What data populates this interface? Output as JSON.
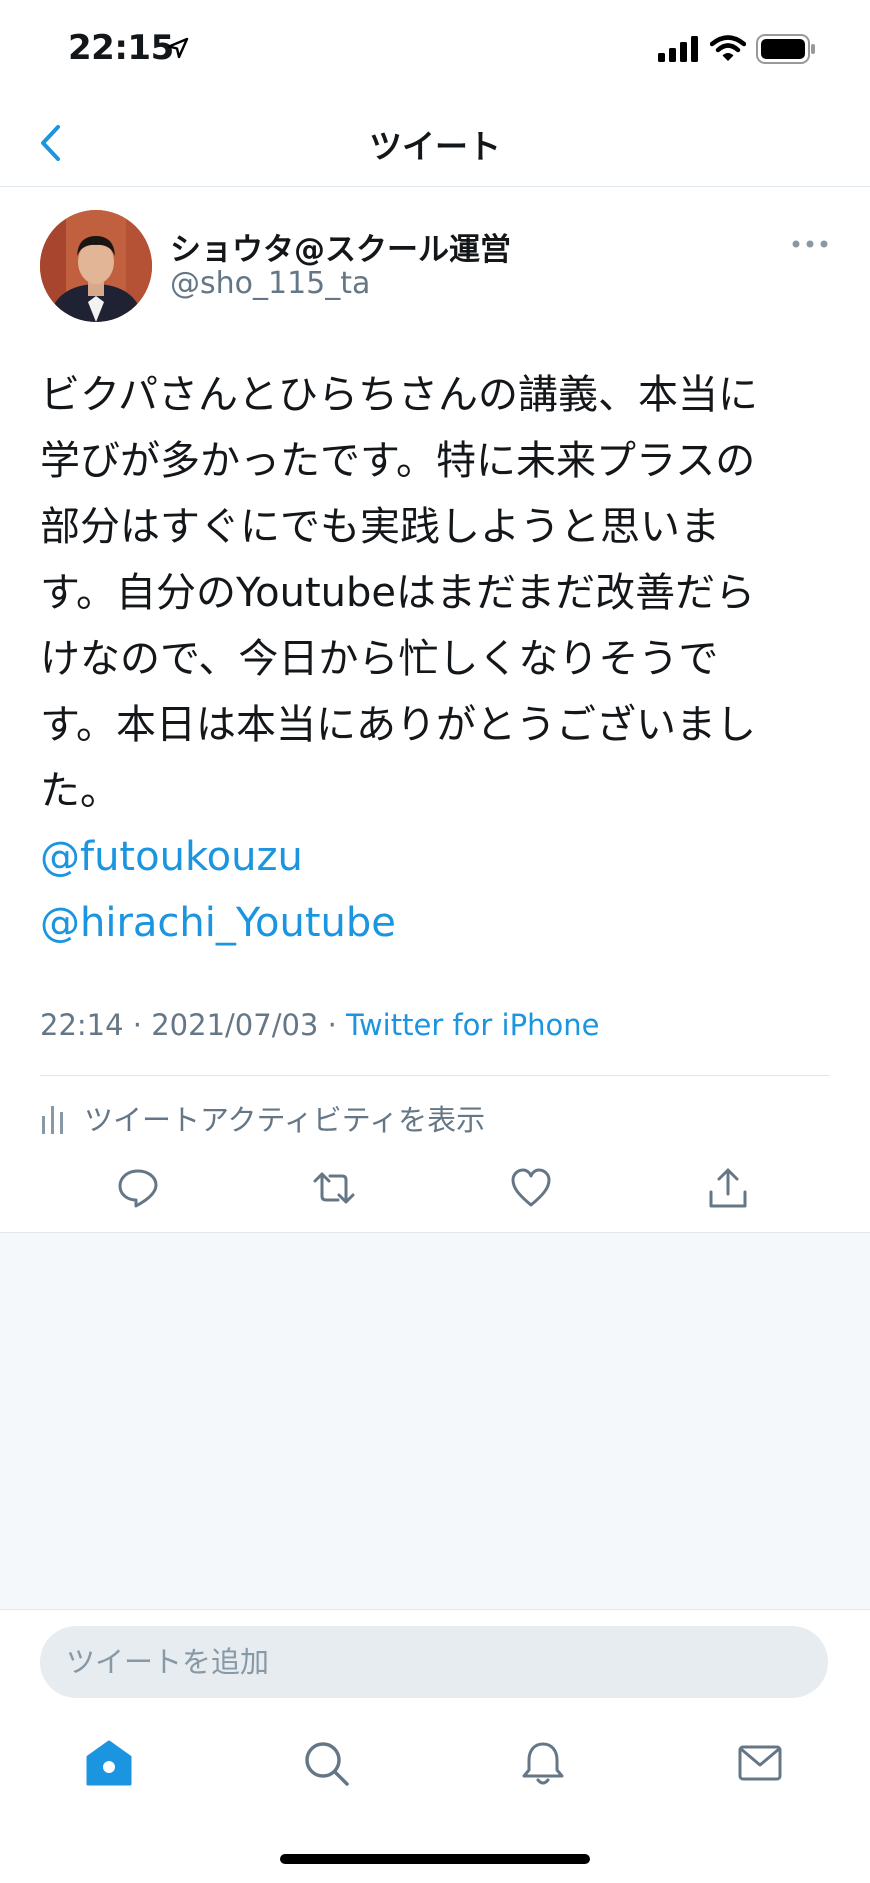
{
  "status_bar": {
    "time": "22:15",
    "icons": [
      "location-arrow-icon",
      "signal-icon",
      "wifi-icon",
      "battery-icon"
    ]
  },
  "header": {
    "title": "ツイート",
    "back_icon": "chevron-left-icon"
  },
  "tweet": {
    "display_name": "ショウタ@スクール運営",
    "handle": "@sho_115_ta",
    "text_lines": [
      "ビクパさんとひらちさんの講義、本当に",
      "学びが多かったです。特に未来プラスの",
      "部分はすぐにでも実践しようと思いま",
      "す。自分のYoutubeはまだまだ改善だら",
      "けなので、今日から忙しくなりそうで",
      "す。本日は本当にありがとうございまし",
      "た。"
    ],
    "mentions": [
      "@futoukouzu",
      "@hirachi_Youtube"
    ],
    "time": "22:14",
    "separator": "·",
    "date": "2021/07/03",
    "source": "Twitter for iPhone",
    "activity_label": "ツイートアクティビティを表示"
  },
  "actions": [
    "reply-icon",
    "retweet-icon",
    "like-icon",
    "share-icon"
  ],
  "reply": {
    "placeholder": "ツイートを追加"
  },
  "tab_bar": [
    "home-icon",
    "search-icon",
    "notifications-icon",
    "messages-icon"
  ],
  "colors": {
    "accent": "#1b95e0",
    "secondary_text": "#657786",
    "divider": "#e1e8ed",
    "background_muted": "#f5f8fa"
  }
}
